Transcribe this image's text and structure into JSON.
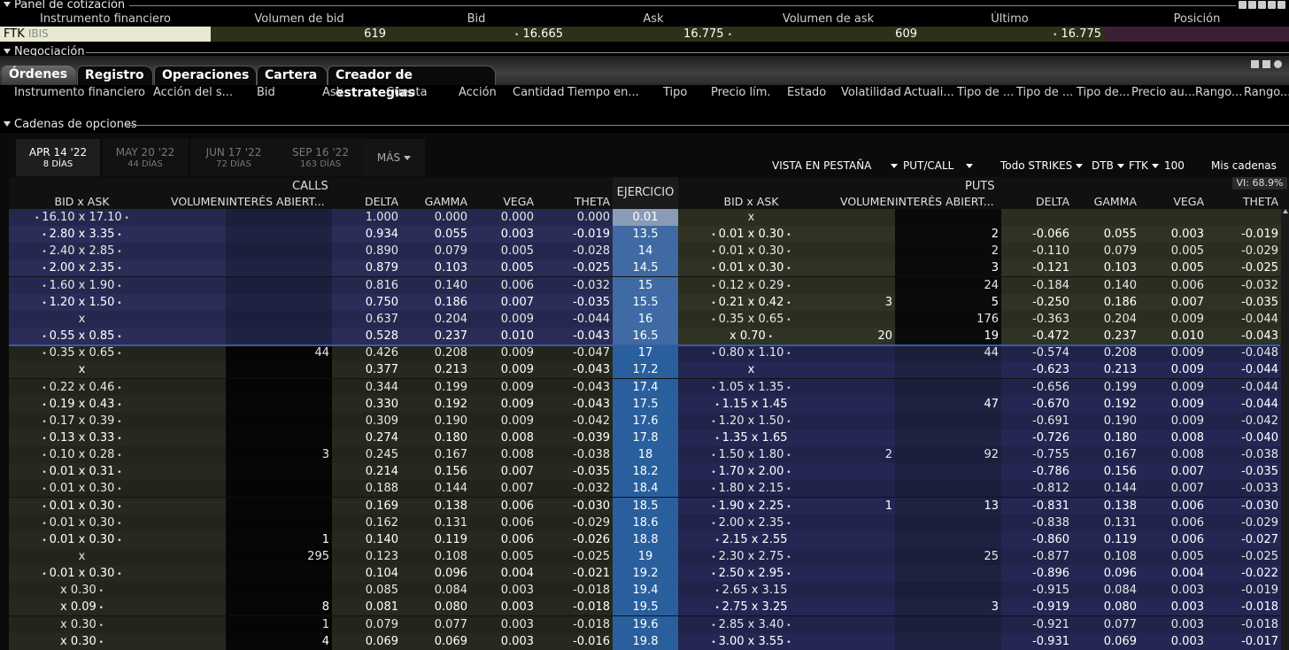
{
  "quote_panel": {
    "title": "Panel de cotización",
    "columns": [
      "Instrumento financiero",
      "Volumen de bid",
      "Bid",
      "Ask",
      "Volumen de ask",
      "Último",
      "Posición"
    ],
    "row": {
      "symbol": "FTK",
      "exchange": "IBIS",
      "bid_size": "619",
      "bid": "16.665",
      "ask": "16.775",
      "ask_size": "609",
      "last": "16.775",
      "position": ""
    }
  },
  "trading": {
    "title": "Negociación",
    "tabs": [
      "Órdenes",
      "Registro",
      "Operaciones",
      "Cartera",
      "Creador de estrategias"
    ],
    "active_tab": "Órdenes",
    "order_columns": [
      "Instrumento financiero",
      "Acción del s...",
      "Bid",
      "Ask",
      "Cuenta",
      "Acción",
      "Cantidad",
      "Tiempo en...",
      "Tipo",
      "Precio lím.",
      "Estado",
      "Volatilidad",
      "Actuali...",
      "Tipo de ...",
      "Tipo de ...",
      "Tipo de...",
      "Precio au...",
      "Rango...",
      "Rango..."
    ]
  },
  "option_chains": {
    "title": "Cadenas de opciones",
    "expiries": [
      {
        "date": "APR 14 '22",
        "days": "8 DÍAS",
        "active": true
      },
      {
        "date": "MAY 20 '22",
        "days": "44 DÍAS",
        "active": false
      },
      {
        "date": "JUN 17 '22",
        "days": "72 DÍAS",
        "active": false
      },
      {
        "date": "SEP 16 '22",
        "days": "163 DÍAS",
        "active": false
      }
    ],
    "more_label": "MÁS",
    "toolbar": {
      "view": "VISTA EN PESTAÑA",
      "putcall": "PUT/CALL",
      "strikes": "Todo STRIKES",
      "exchange": "DTB",
      "underlying": "FTK",
      "multiplier": "100",
      "my_chains": "Mis cadenas"
    },
    "vi_label": "VI: 68.9%",
    "calls_label": "CALLS",
    "puts_label": "PUTS",
    "strike_header": "EJERCICIO",
    "side_columns": [
      "BID x ASK",
      "VOLUMEN",
      "INTERÉS ABIERT...",
      "DELTA",
      "GAMMA",
      "VEGA",
      "THETA"
    ],
    "colors": {
      "call_itm": "#25284e",
      "call_otm": "#22251a",
      "put_itm": "#20234a",
      "put_otm": "#2b2d1f",
      "strike_itm": "#2a5f9e",
      "strike_otm": "#3f6aa3",
      "atm_line": "#3a5aa8"
    },
    "rows": [
      {
        "strike": "0.01",
        "c_ba": "16.10 x 17.10",
        "c_vol": "",
        "c_oi": "",
        "c_d": "1.000",
        "c_g": "0.000",
        "c_v": "0.000",
        "c_t": "0.000",
        "p_ba": "x",
        "p_vol": "",
        "p_oi": "",
        "p_d": "",
        "p_g": "",
        "p_v": "",
        "p_t": ""
      },
      {
        "strike": "13.5",
        "c_ba": "2.80 x 3.35",
        "c_vol": "",
        "c_oi": "",
        "c_d": "0.934",
        "c_g": "0.055",
        "c_v": "0.003",
        "c_t": "-0.019",
        "p_ba": "0.01 x 0.30",
        "p_vol": "",
        "p_oi": "2",
        "p_d": "-0.066",
        "p_g": "0.055",
        "p_v": "0.003",
        "p_t": "-0.019"
      },
      {
        "strike": "14",
        "c_ba": "2.40 x 2.85",
        "c_vol": "",
        "c_oi": "",
        "c_d": "0.890",
        "c_g": "0.079",
        "c_v": "0.005",
        "c_t": "-0.028",
        "p_ba": "0.01 x 0.30",
        "p_vol": "",
        "p_oi": "2",
        "p_d": "-0.110",
        "p_g": "0.079",
        "p_v": "0.005",
        "p_t": "-0.029"
      },
      {
        "strike": "14.5",
        "c_ba": "2.00 x 2.35",
        "c_vol": "",
        "c_oi": "",
        "c_d": "0.879",
        "c_g": "0.103",
        "c_v": "0.005",
        "c_t": "-0.025",
        "p_ba": "0.01 x 0.30",
        "p_vol": "",
        "p_oi": "3",
        "p_d": "-0.121",
        "p_g": "0.103",
        "p_v": "0.005",
        "p_t": "-0.025"
      },
      {
        "strike": "15",
        "c_ba": "1.60 x 1.90",
        "c_vol": "",
        "c_oi": "",
        "c_d": "0.816",
        "c_g": "0.140",
        "c_v": "0.006",
        "c_t": "-0.032",
        "p_ba": "0.12 x 0.29",
        "p_vol": "",
        "p_oi": "24",
        "p_d": "-0.184",
        "p_g": "0.140",
        "p_v": "0.006",
        "p_t": "-0.032"
      },
      {
        "strike": "15.5",
        "c_ba": "1.20 x 1.50",
        "c_vol": "",
        "c_oi": "",
        "c_d": "0.750",
        "c_g": "0.186",
        "c_v": "0.007",
        "c_t": "-0.035",
        "p_ba": "0.21 x 0.42",
        "p_vol": "3",
        "p_oi": "5",
        "p_d": "-0.250",
        "p_g": "0.186",
        "p_v": "0.007",
        "p_t": "-0.035"
      },
      {
        "strike": "16",
        "c_ba": "x",
        "c_vol": "",
        "c_oi": "",
        "c_d": "0.637",
        "c_g": "0.204",
        "c_v": "0.009",
        "c_t": "-0.044",
        "p_ba": "0.35 x 0.65",
        "p_vol": "",
        "p_oi": "176",
        "p_d": "-0.363",
        "p_g": "0.204",
        "p_v": "0.009",
        "p_t": "-0.044"
      },
      {
        "strike": "16.5",
        "c_ba": "0.55 x 0.85",
        "c_vol": "",
        "c_oi": "",
        "c_d": "0.528",
        "c_g": "0.237",
        "c_v": "0.010",
        "c_t": "-0.043",
        "p_ba": "x 0.70",
        "p_vol": "20",
        "p_oi": "19",
        "p_d": "-0.472",
        "p_g": "0.237",
        "p_v": "0.010",
        "p_t": "-0.043"
      },
      {
        "strike": "17",
        "c_ba": "0.35 x 0.65",
        "c_vol": "",
        "c_oi": "44",
        "c_d": "0.426",
        "c_g": "0.208",
        "c_v": "0.009",
        "c_t": "-0.047",
        "p_ba": "0.80 x 1.10",
        "p_vol": "",
        "p_oi": "44",
        "p_d": "-0.574",
        "p_g": "0.208",
        "p_v": "0.009",
        "p_t": "-0.048"
      },
      {
        "strike": "17.2",
        "c_ba": "x",
        "c_vol": "",
        "c_oi": "",
        "c_d": "0.377",
        "c_g": "0.213",
        "c_v": "0.009",
        "c_t": "-0.043",
        "p_ba": "x",
        "p_vol": "",
        "p_oi": "",
        "p_d": "-0.623",
        "p_g": "0.213",
        "p_v": "0.009",
        "p_t": "-0.044"
      },
      {
        "strike": "17.4",
        "c_ba": "0.22 x 0.46",
        "c_vol": "",
        "c_oi": "",
        "c_d": "0.344",
        "c_g": "0.199",
        "c_v": "0.009",
        "c_t": "-0.043",
        "p_ba": "1.05 x 1.35",
        "p_vol": "",
        "p_oi": "",
        "p_d": "-0.656",
        "p_g": "0.199",
        "p_v": "0.009",
        "p_t": "-0.044"
      },
      {
        "strike": "17.5",
        "c_ba": "0.19 x 0.43",
        "c_vol": "",
        "c_oi": "",
        "c_d": "0.330",
        "c_g": "0.192",
        "c_v": "0.009",
        "c_t": "-0.043",
        "p_ba": "1.15 x 1.45",
        "p_vol": "",
        "p_oi": "47",
        "p_d": "-0.670",
        "p_g": "0.192",
        "p_v": "0.009",
        "p_t": "-0.044"
      },
      {
        "strike": "17.6",
        "c_ba": "0.17 x 0.39",
        "c_vol": "",
        "c_oi": "",
        "c_d": "0.309",
        "c_g": "0.190",
        "c_v": "0.009",
        "c_t": "-0.042",
        "p_ba": "1.20 x 1.50",
        "p_vol": "",
        "p_oi": "",
        "p_d": "-0.691",
        "p_g": "0.190",
        "p_v": "0.009",
        "p_t": "-0.042"
      },
      {
        "strike": "17.8",
        "c_ba": "0.13 x 0.33",
        "c_vol": "",
        "c_oi": "",
        "c_d": "0.274",
        "c_g": "0.180",
        "c_v": "0.008",
        "c_t": "-0.039",
        "p_ba": "1.35 x 1.65",
        "p_vol": "",
        "p_oi": "",
        "p_d": "-0.726",
        "p_g": "0.180",
        "p_v": "0.008",
        "p_t": "-0.040"
      },
      {
        "strike": "18",
        "c_ba": "0.10 x 0.28",
        "c_vol": "",
        "c_oi": "3",
        "c_d": "0.245",
        "c_g": "0.167",
        "c_v": "0.008",
        "c_t": "-0.038",
        "p_ba": "1.50 x 1.80",
        "p_vol": "2",
        "p_oi": "92",
        "p_d": "-0.755",
        "p_g": "0.167",
        "p_v": "0.008",
        "p_t": "-0.038"
      },
      {
        "strike": "18.2",
        "c_ba": "0.01 x 0.31",
        "c_vol": "",
        "c_oi": "",
        "c_d": "0.214",
        "c_g": "0.156",
        "c_v": "0.007",
        "c_t": "-0.035",
        "p_ba": "1.70 x 2.00",
        "p_vol": "",
        "p_oi": "",
        "p_d": "-0.786",
        "p_g": "0.156",
        "p_v": "0.007",
        "p_t": "-0.035"
      },
      {
        "strike": "18.4",
        "c_ba": "0.01 x 0.30",
        "c_vol": "",
        "c_oi": "",
        "c_d": "0.188",
        "c_g": "0.144",
        "c_v": "0.007",
        "c_t": "-0.032",
        "p_ba": "1.80 x 2.15",
        "p_vol": "",
        "p_oi": "",
        "p_d": "-0.812",
        "p_g": "0.144",
        "p_v": "0.007",
        "p_t": "-0.033"
      },
      {
        "strike": "18.5",
        "c_ba": "0.01 x 0.30",
        "c_vol": "",
        "c_oi": "",
        "c_d": "0.169",
        "c_g": "0.138",
        "c_v": "0.006",
        "c_t": "-0.030",
        "p_ba": "1.90 x 2.25",
        "p_vol": "1",
        "p_oi": "13",
        "p_d": "-0.831",
        "p_g": "0.138",
        "p_v": "0.006",
        "p_t": "-0.030"
      },
      {
        "strike": "18.6",
        "c_ba": "0.01 x 0.30",
        "c_vol": "",
        "c_oi": "",
        "c_d": "0.162",
        "c_g": "0.131",
        "c_v": "0.006",
        "c_t": "-0.029",
        "p_ba": "2.00 x 2.35",
        "p_vol": "",
        "p_oi": "",
        "p_d": "-0.838",
        "p_g": "0.131",
        "p_v": "0.006",
        "p_t": "-0.029"
      },
      {
        "strike": "18.8",
        "c_ba": "0.01 x 0.30",
        "c_vol": "",
        "c_oi": "1",
        "c_d": "0.140",
        "c_g": "0.119",
        "c_v": "0.006",
        "c_t": "-0.026",
        "p_ba": "2.15 x 2.55",
        "p_vol": "",
        "p_oi": "",
        "p_d": "-0.860",
        "p_g": "0.119",
        "p_v": "0.006",
        "p_t": "-0.027"
      },
      {
        "strike": "19",
        "c_ba": "x",
        "c_vol": "",
        "c_oi": "295",
        "c_d": "0.123",
        "c_g": "0.108",
        "c_v": "0.005",
        "c_t": "-0.025",
        "p_ba": "2.30 x 2.75",
        "p_vol": "",
        "p_oi": "25",
        "p_d": "-0.877",
        "p_g": "0.108",
        "p_v": "0.005",
        "p_t": "-0.025"
      },
      {
        "strike": "19.2",
        "c_ba": "0.01 x 0.30",
        "c_vol": "",
        "c_oi": "",
        "c_d": "0.104",
        "c_g": "0.096",
        "c_v": "0.004",
        "c_t": "-0.021",
        "p_ba": "2.50 x 2.95",
        "p_vol": "",
        "p_oi": "",
        "p_d": "-0.896",
        "p_g": "0.096",
        "p_v": "0.004",
        "p_t": "-0.022"
      },
      {
        "strike": "19.4",
        "c_ba": "x 0.30",
        "c_vol": "",
        "c_oi": "",
        "c_d": "0.085",
        "c_g": "0.084",
        "c_v": "0.003",
        "c_t": "-0.018",
        "p_ba": "2.65 x 3.15",
        "p_vol": "",
        "p_oi": "",
        "p_d": "-0.915",
        "p_g": "0.084",
        "p_v": "0.003",
        "p_t": "-0.019"
      },
      {
        "strike": "19.5",
        "c_ba": "x 0.09",
        "c_vol": "",
        "c_oi": "8",
        "c_d": "0.081",
        "c_g": "0.080",
        "c_v": "0.003",
        "c_t": "-0.018",
        "p_ba": "2.75 x 3.25",
        "p_vol": "",
        "p_oi": "3",
        "p_d": "-0.919",
        "p_g": "0.080",
        "p_v": "0.003",
        "p_t": "-0.018"
      },
      {
        "strike": "19.6",
        "c_ba": "x 0.30",
        "c_vol": "",
        "c_oi": "1",
        "c_d": "0.079",
        "c_g": "0.077",
        "c_v": "0.003",
        "c_t": "-0.018",
        "p_ba": "2.85 x 3.40",
        "p_vol": "",
        "p_oi": "",
        "p_d": "-0.921",
        "p_g": "0.077",
        "p_v": "0.003",
        "p_t": "-0.018"
      },
      {
        "strike": "19.8",
        "c_ba": "x 0.30",
        "c_vol": "",
        "c_oi": "4",
        "c_d": "0.069",
        "c_g": "0.069",
        "c_v": "0.003",
        "c_t": "-0.016",
        "p_ba": "3.00 x 3.55",
        "p_vol": "",
        "p_oi": "",
        "p_d": "-0.931",
        "p_g": "0.069",
        "p_v": "0.003",
        "p_t": "-0.017"
      }
    ]
  }
}
